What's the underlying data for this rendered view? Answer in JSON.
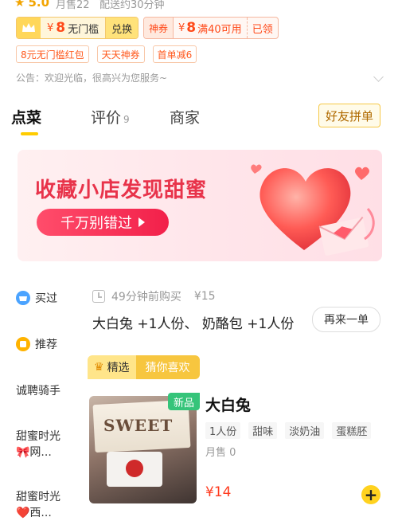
{
  "store": {
    "rating": "5.0",
    "monthly_sales": "月售22",
    "delivery": "配送约30分钟"
  },
  "coupons": {
    "main": {
      "amount": "8",
      "currency": "¥",
      "label": "无门槛",
      "action": "兑换"
    },
    "god": {
      "badge": "神券",
      "currency": "¥",
      "amount": "8",
      "label": "满40可用",
      "status": "已领"
    }
  },
  "promotions": [
    "8元无门槛红包",
    "天天神券",
    "首单减6"
  ],
  "notice": "公告：欢迎光临，很高兴为您服务~",
  "tabs": [
    {
      "label": "点菜"
    },
    {
      "label": "评价",
      "count": "9"
    },
    {
      "label": "商家"
    }
  ],
  "group_order_label": "好友拼单",
  "banner": {
    "title": "收藏小店发现甜蜜",
    "button": "千万别错过"
  },
  "sidebar": {
    "items": [
      {
        "label": "买过",
        "icon": "basket-icon"
      },
      {
        "label": "推荐",
        "icon": "recommend-icon"
      },
      {
        "label": "诚聘骑手"
      },
      {
        "label": "甜蜜时光",
        "sub": "🎀网..."
      },
      {
        "label": "甜蜜时光",
        "sub": "❤️西..."
      }
    ]
  },
  "history": {
    "time": "49分钟前购买",
    "price": "¥15",
    "items": "大白兔 +1人份、 奶酪包 +1人份",
    "reorder": "再来一单"
  },
  "section_tags": {
    "pick": "精选",
    "guess": "猜你喜欢"
  },
  "product": {
    "badge": "新品",
    "image_text": "SWEET",
    "name": "大白兔",
    "tags": [
      "1人份",
      "甜味",
      "淡奶油",
      "蛋糕胚"
    ],
    "sales": "月售 0",
    "price": "¥14",
    "add": "+"
  },
  "colors": {
    "accent": "#ffd21f",
    "price": "#ff3b1f",
    "banner_red": "#e8334a"
  }
}
